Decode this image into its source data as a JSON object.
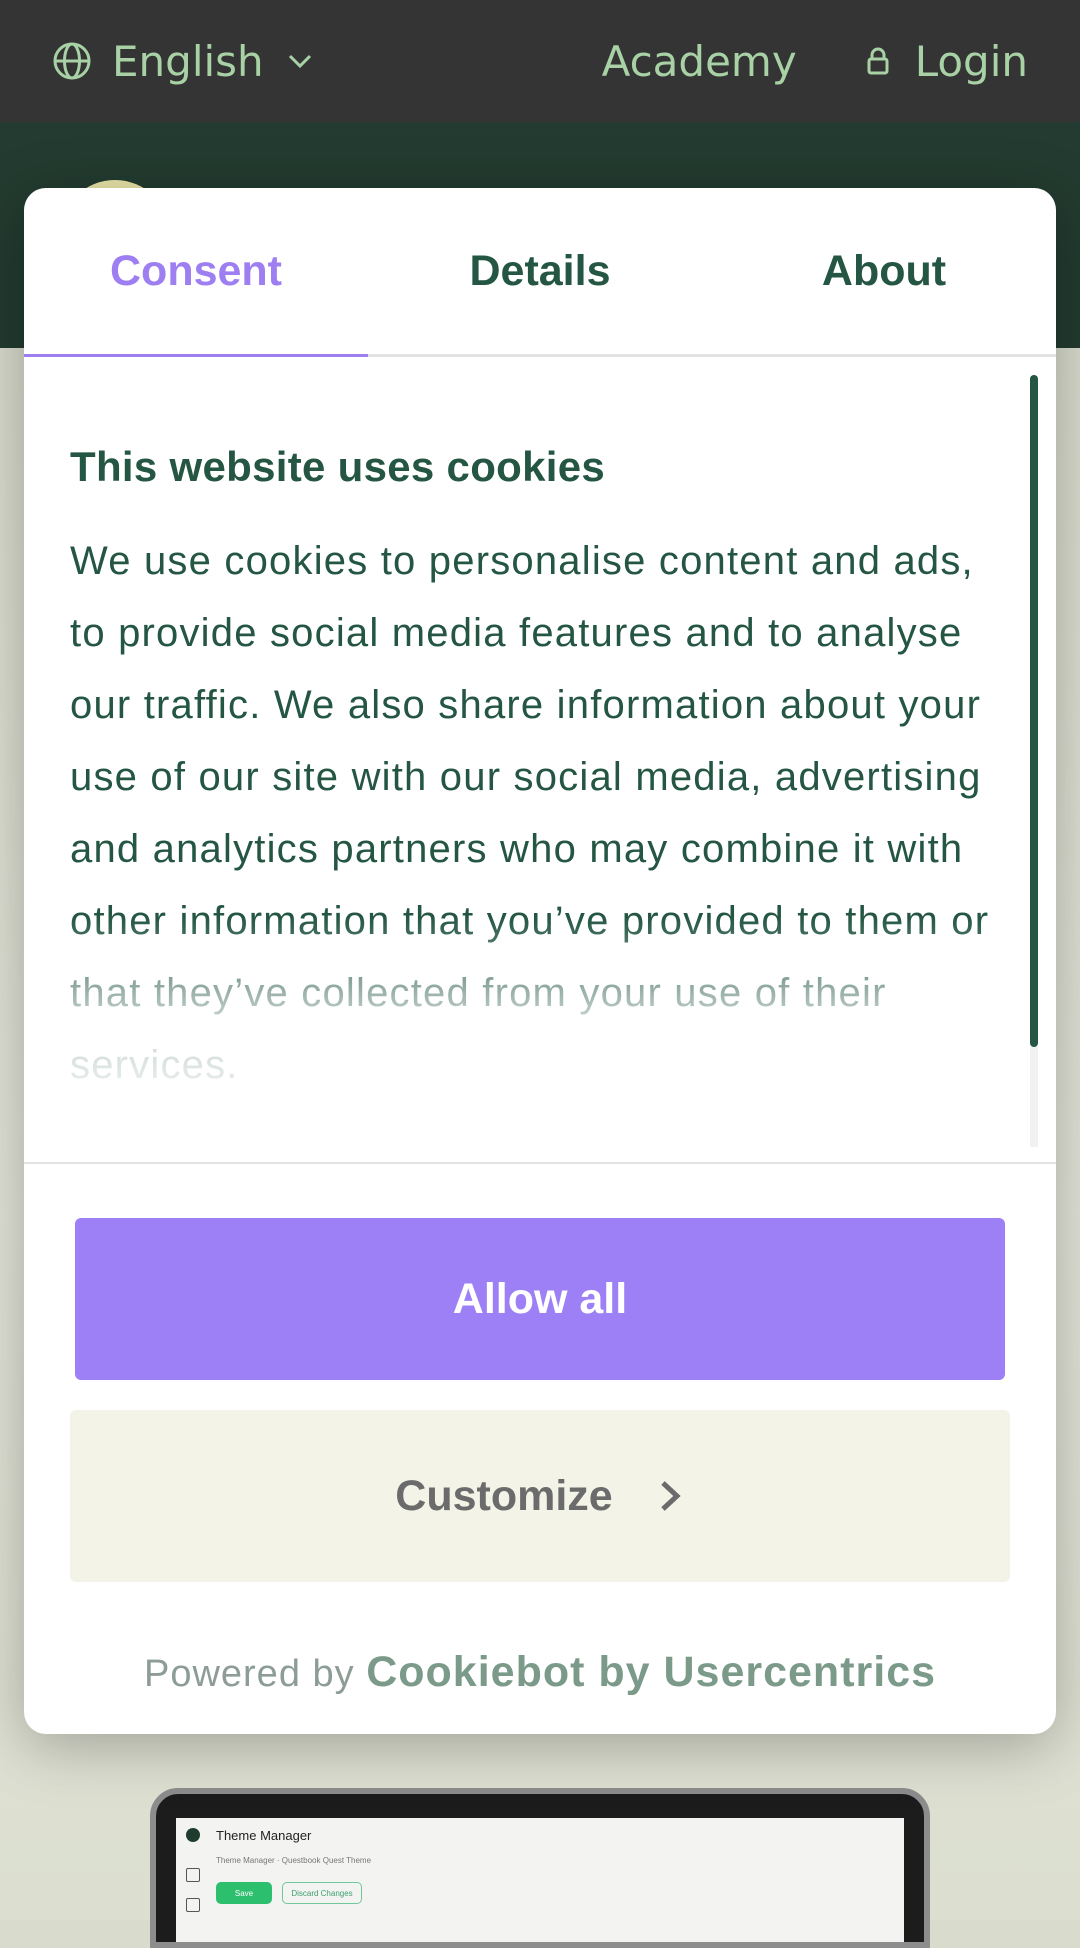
{
  "header": {
    "language": "English",
    "academy": "Academy",
    "login": "Login"
  },
  "dialog": {
    "tabs": [
      {
        "label": "Consent",
        "active": true
      },
      {
        "label": "Details",
        "active": false
      },
      {
        "label": "About",
        "active": false
      }
    ],
    "heading": "This website uses cookies",
    "body": "We use cookies to personalise content and ads, to provide social media features and to analyse our traffic. We also share information about your use of our site with our social media, advertising and analytics partners who may combine it with other information that you’ve provided to them or that they’ve collected from your use of their services.",
    "allow_all": "Allow all",
    "customize": "Customize",
    "powered_prefix": "Powered by",
    "powered_brand": "Cookiebot by Usercentrics"
  },
  "background": {
    "laptop_app_title": "Theme Manager",
    "laptop_crumb": "Theme Manager  ·  Questbook Quest Theme",
    "laptop_save": "Save",
    "laptop_discard": "Discard Changes"
  },
  "colors": {
    "accent": "#9d80f5",
    "text_green": "#245643",
    "topbar": "#333433",
    "nav_text": "#a9d1a6"
  }
}
